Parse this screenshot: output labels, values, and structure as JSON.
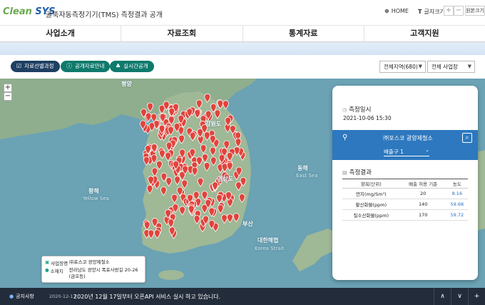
{
  "header": {
    "logo_clean": "Clean",
    "logo_sys": "SYS",
    "site_title": "굴뚝자동측정기기(TMS) 측정결과 공개",
    "home_label": "HOME",
    "font_label": "글자크기",
    "font_plus": "+",
    "font_minus": "−",
    "original_size": "원본크기"
  },
  "nav": {
    "items": [
      {
        "label": "사업소개"
      },
      {
        "label": "자료조회"
      },
      {
        "label": "통계자료"
      },
      {
        "label": "고객지원"
      }
    ]
  },
  "filters": {
    "btn_selection": "자료선별과정",
    "btn_info": "공개자료안내",
    "btn_realtime": "실시간공개",
    "region_value": "전체지역(680)",
    "site_value": "전체 사업장"
  },
  "map": {
    "zoom_in": "+",
    "zoom_out": "−",
    "labels": {
      "pyongyang": "평양",
      "gangwon": "강원도",
      "yellow_sea_kr": "황해",
      "yellow_sea_en": "Yellow Sea",
      "east_sea_kr": "동해",
      "east_sea_en": "East Sea",
      "korea_strait_kr": "대한해협",
      "korea_strait_en": "Korea Strait",
      "gyeongsang": "경상도",
      "busan": "부산"
    },
    "facility_popup": {
      "name_key": "사업장명",
      "name_value": "㈜포스코 광양제철소",
      "addr_key": "소재지",
      "addr_value": "전라남도 광양시 폭포사랑길 20-26 (금호동)"
    }
  },
  "panel": {
    "datetime_label": "측정일시",
    "datetime_value": "2021-10-06 15:30",
    "facility_name": "㈜포스코 광양제철소",
    "outlet_value": "배출구 1",
    "result_label": "측정결과",
    "table": {
      "headers": [
        "항목(단위)",
        "배출 허용 기준",
        "농도"
      ],
      "rows": [
        {
          "item": "먼지(mg/Sm³)",
          "limit": "20",
          "value": "8.16"
        },
        {
          "item": "황산화물(ppm)",
          "limit": "140",
          "value": "59.68"
        },
        {
          "item": "질소산화물(ppm)",
          "limit": "170",
          "value": "59.72"
        }
      ]
    }
  },
  "notice": {
    "label": "공지사항",
    "date": "2020-12-17",
    "message": "2020년 12월 17일부터 오픈API 서비스 실시 하고 있습니다."
  },
  "colors": {
    "accent_blue": "#2d78bf",
    "teal": "#0f7a6c",
    "navy": "#1f3f63",
    "marker_red": "#e0443c",
    "sea": "#6ba2b4",
    "notice_bg": "#232c3a"
  }
}
